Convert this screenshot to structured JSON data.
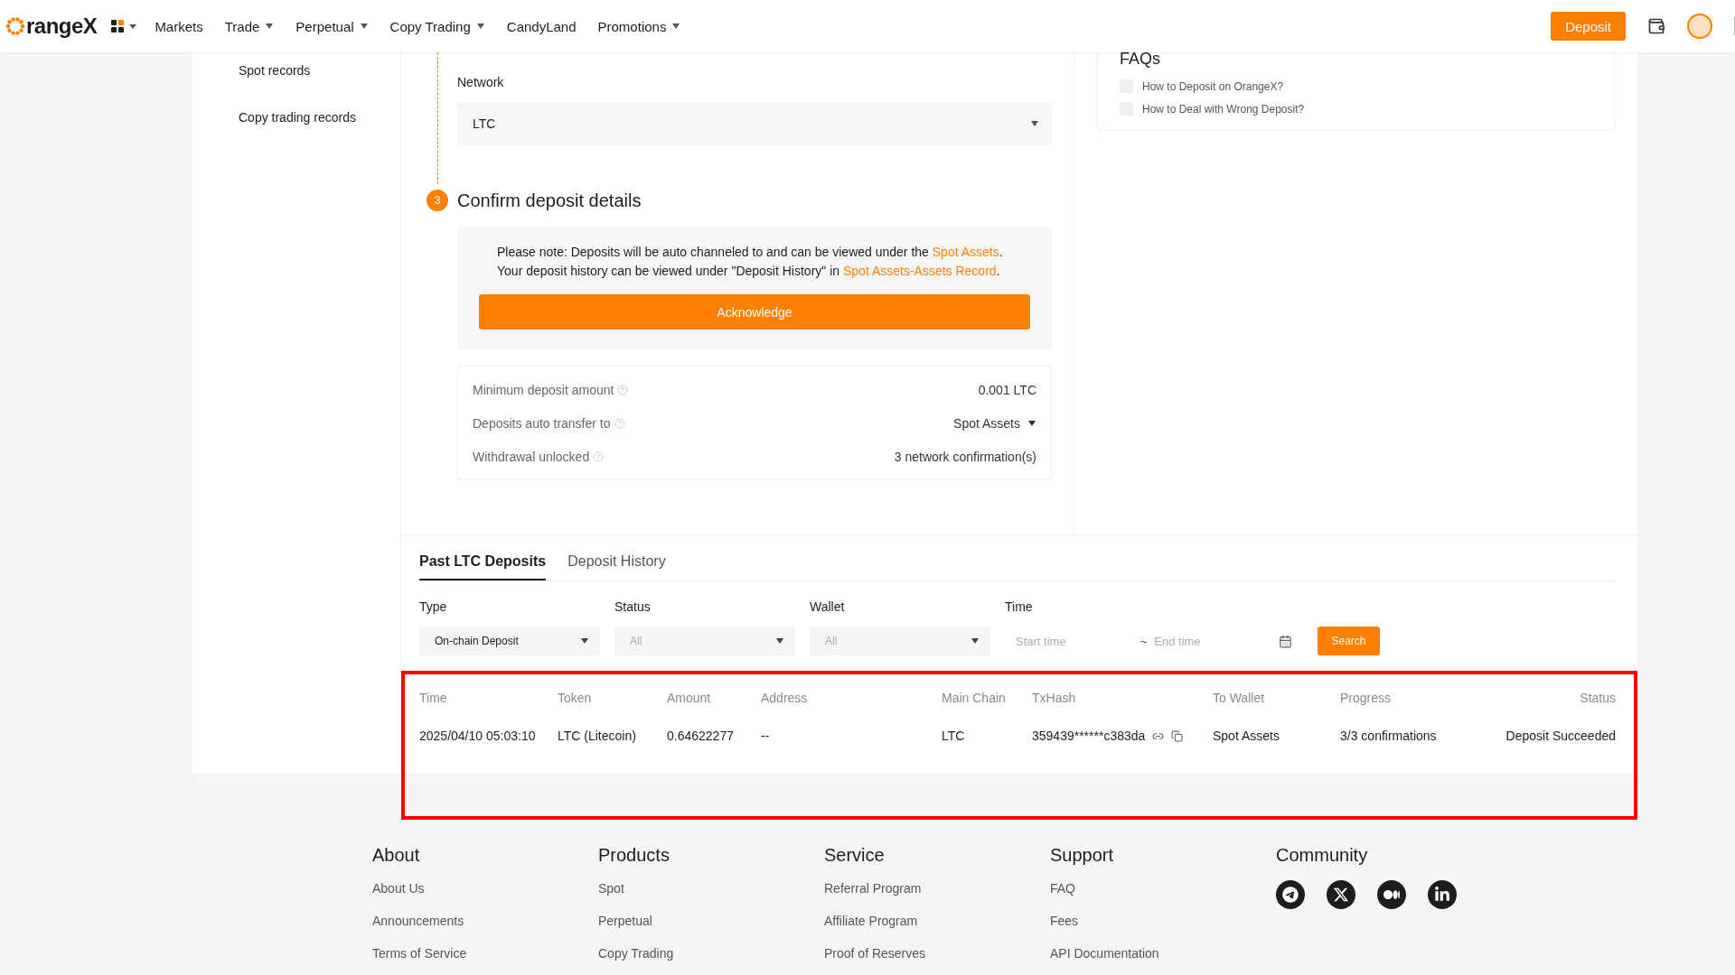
{
  "header": {
    "logo": "rangeX",
    "nav": [
      {
        "label": "Markets",
        "has_menu": false
      },
      {
        "label": "Trade",
        "has_menu": true
      },
      {
        "label": "Perpetual",
        "has_menu": true
      },
      {
        "label": "Copy Trading",
        "has_menu": true
      },
      {
        "label": "CandyLand",
        "has_menu": false
      },
      {
        "label": "Promotions",
        "has_menu": true
      }
    ],
    "deposit_button": "Deposit"
  },
  "sidebar": {
    "items": [
      {
        "label": "Spot records",
        "selected": false
      },
      {
        "label": "Copy trading records",
        "selected": false
      }
    ]
  },
  "network": {
    "label": "Network",
    "value": "LTC"
  },
  "step": {
    "number": "3",
    "title": "Confirm deposit details"
  },
  "notice": {
    "lines": [
      {
        "text": "Please note: Deposits will be auto channeled to and can be viewed under the ",
        "link": "Spot Assets",
        "suffix": "."
      },
      {
        "text": "Your deposit history can be viewed under \"Deposit History\" in ",
        "link": "Spot Assets-Assets Record",
        "suffix": "."
      }
    ],
    "button": "Acknowledge"
  },
  "details": [
    {
      "label": "Minimum deposit amount",
      "value": "0.001 LTC",
      "has_menu": false
    },
    {
      "label": "Deposits auto transfer to",
      "value": "Spot Assets",
      "has_menu": true
    },
    {
      "label": "Withdrawal unlocked",
      "value": "3 network confirmation(s)",
      "has_menu": false
    }
  ],
  "faqs": {
    "title": "FAQs",
    "items": [
      "How to Deposit on OrangeX?",
      "How to Deal with Wrong Deposit?"
    ]
  },
  "tabs": [
    {
      "label": "Past LTC Deposits",
      "selected": true
    },
    {
      "label": "Deposit History",
      "selected": false
    }
  ],
  "filters": [
    {
      "kind": "select",
      "label": "Type",
      "value": "On-chain Deposit"
    },
    {
      "kind": "select",
      "label": "Status",
      "placeholder": "All"
    },
    {
      "kind": "select",
      "label": "Wallet",
      "placeholder": "All"
    },
    {
      "kind": "range",
      "label": "Time",
      "start_placeholder": "Start time",
      "separator": "~",
      "end_placeholder": "End time"
    }
  ],
  "search_button": "Search",
  "table": {
    "columns": [
      "Time",
      "Token",
      "Amount",
      "Address",
      "Main Chain",
      "TxHash",
      "To Wallet",
      "Progress",
      "Status"
    ],
    "rows": [
      [
        "2025/04/10 05:03:10",
        "LTC (Litecoin)",
        "0.64622277",
        "--",
        "LTC",
        "359439******c383da",
        "Spot Assets",
        "3/3 confirmations",
        "Deposit Succeeded"
      ]
    ]
  },
  "footer": [
    {
      "title": "About",
      "links": [
        "About Us",
        "Announcements",
        "Terms of Service"
      ]
    },
    {
      "title": "Products",
      "links": [
        "Spot",
        "Perpetual",
        "Copy Trading"
      ]
    },
    {
      "title": "Service",
      "links": [
        "Referral Program",
        "Affiliate Program",
        "Proof of Reserves"
      ]
    },
    {
      "title": "Support",
      "links": [
        "FAQ",
        "Fees",
        "API Documentation"
      ]
    },
    {
      "title": "Community",
      "kind": "social"
    }
  ]
}
